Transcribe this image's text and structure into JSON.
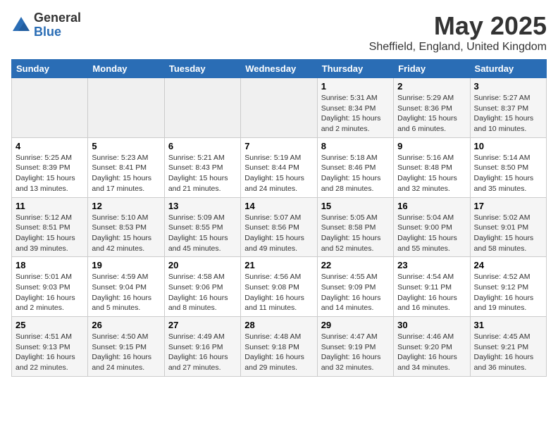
{
  "logo": {
    "general": "General",
    "blue": "Blue"
  },
  "title": "May 2025",
  "subtitle": "Sheffield, England, United Kingdom",
  "days_header": [
    "Sunday",
    "Monday",
    "Tuesday",
    "Wednesday",
    "Thursday",
    "Friday",
    "Saturday"
  ],
  "weeks": [
    [
      {
        "num": "",
        "detail": ""
      },
      {
        "num": "",
        "detail": ""
      },
      {
        "num": "",
        "detail": ""
      },
      {
        "num": "",
        "detail": ""
      },
      {
        "num": "1",
        "detail": "Sunrise: 5:31 AM\nSunset: 8:34 PM\nDaylight: 15 hours\nand 2 minutes."
      },
      {
        "num": "2",
        "detail": "Sunrise: 5:29 AM\nSunset: 8:36 PM\nDaylight: 15 hours\nand 6 minutes."
      },
      {
        "num": "3",
        "detail": "Sunrise: 5:27 AM\nSunset: 8:37 PM\nDaylight: 15 hours\nand 10 minutes."
      }
    ],
    [
      {
        "num": "4",
        "detail": "Sunrise: 5:25 AM\nSunset: 8:39 PM\nDaylight: 15 hours\nand 13 minutes."
      },
      {
        "num": "5",
        "detail": "Sunrise: 5:23 AM\nSunset: 8:41 PM\nDaylight: 15 hours\nand 17 minutes."
      },
      {
        "num": "6",
        "detail": "Sunrise: 5:21 AM\nSunset: 8:43 PM\nDaylight: 15 hours\nand 21 minutes."
      },
      {
        "num": "7",
        "detail": "Sunrise: 5:19 AM\nSunset: 8:44 PM\nDaylight: 15 hours\nand 24 minutes."
      },
      {
        "num": "8",
        "detail": "Sunrise: 5:18 AM\nSunset: 8:46 PM\nDaylight: 15 hours\nand 28 minutes."
      },
      {
        "num": "9",
        "detail": "Sunrise: 5:16 AM\nSunset: 8:48 PM\nDaylight: 15 hours\nand 32 minutes."
      },
      {
        "num": "10",
        "detail": "Sunrise: 5:14 AM\nSunset: 8:50 PM\nDaylight: 15 hours\nand 35 minutes."
      }
    ],
    [
      {
        "num": "11",
        "detail": "Sunrise: 5:12 AM\nSunset: 8:51 PM\nDaylight: 15 hours\nand 39 minutes."
      },
      {
        "num": "12",
        "detail": "Sunrise: 5:10 AM\nSunset: 8:53 PM\nDaylight: 15 hours\nand 42 minutes."
      },
      {
        "num": "13",
        "detail": "Sunrise: 5:09 AM\nSunset: 8:55 PM\nDaylight: 15 hours\nand 45 minutes."
      },
      {
        "num": "14",
        "detail": "Sunrise: 5:07 AM\nSunset: 8:56 PM\nDaylight: 15 hours\nand 49 minutes."
      },
      {
        "num": "15",
        "detail": "Sunrise: 5:05 AM\nSunset: 8:58 PM\nDaylight: 15 hours\nand 52 minutes."
      },
      {
        "num": "16",
        "detail": "Sunrise: 5:04 AM\nSunset: 9:00 PM\nDaylight: 15 hours\nand 55 minutes."
      },
      {
        "num": "17",
        "detail": "Sunrise: 5:02 AM\nSunset: 9:01 PM\nDaylight: 15 hours\nand 58 minutes."
      }
    ],
    [
      {
        "num": "18",
        "detail": "Sunrise: 5:01 AM\nSunset: 9:03 PM\nDaylight: 16 hours\nand 2 minutes."
      },
      {
        "num": "19",
        "detail": "Sunrise: 4:59 AM\nSunset: 9:04 PM\nDaylight: 16 hours\nand 5 minutes."
      },
      {
        "num": "20",
        "detail": "Sunrise: 4:58 AM\nSunset: 9:06 PM\nDaylight: 16 hours\nand 8 minutes."
      },
      {
        "num": "21",
        "detail": "Sunrise: 4:56 AM\nSunset: 9:08 PM\nDaylight: 16 hours\nand 11 minutes."
      },
      {
        "num": "22",
        "detail": "Sunrise: 4:55 AM\nSunset: 9:09 PM\nDaylight: 16 hours\nand 14 minutes."
      },
      {
        "num": "23",
        "detail": "Sunrise: 4:54 AM\nSunset: 9:11 PM\nDaylight: 16 hours\nand 16 minutes."
      },
      {
        "num": "24",
        "detail": "Sunrise: 4:52 AM\nSunset: 9:12 PM\nDaylight: 16 hours\nand 19 minutes."
      }
    ],
    [
      {
        "num": "25",
        "detail": "Sunrise: 4:51 AM\nSunset: 9:13 PM\nDaylight: 16 hours\nand 22 minutes."
      },
      {
        "num": "26",
        "detail": "Sunrise: 4:50 AM\nSunset: 9:15 PM\nDaylight: 16 hours\nand 24 minutes."
      },
      {
        "num": "27",
        "detail": "Sunrise: 4:49 AM\nSunset: 9:16 PM\nDaylight: 16 hours\nand 27 minutes."
      },
      {
        "num": "28",
        "detail": "Sunrise: 4:48 AM\nSunset: 9:18 PM\nDaylight: 16 hours\nand 29 minutes."
      },
      {
        "num": "29",
        "detail": "Sunrise: 4:47 AM\nSunset: 9:19 PM\nDaylight: 16 hours\nand 32 minutes."
      },
      {
        "num": "30",
        "detail": "Sunrise: 4:46 AM\nSunset: 9:20 PM\nDaylight: 16 hours\nand 34 minutes."
      },
      {
        "num": "31",
        "detail": "Sunrise: 4:45 AM\nSunset: 9:21 PM\nDaylight: 16 hours\nand 36 minutes."
      }
    ]
  ]
}
